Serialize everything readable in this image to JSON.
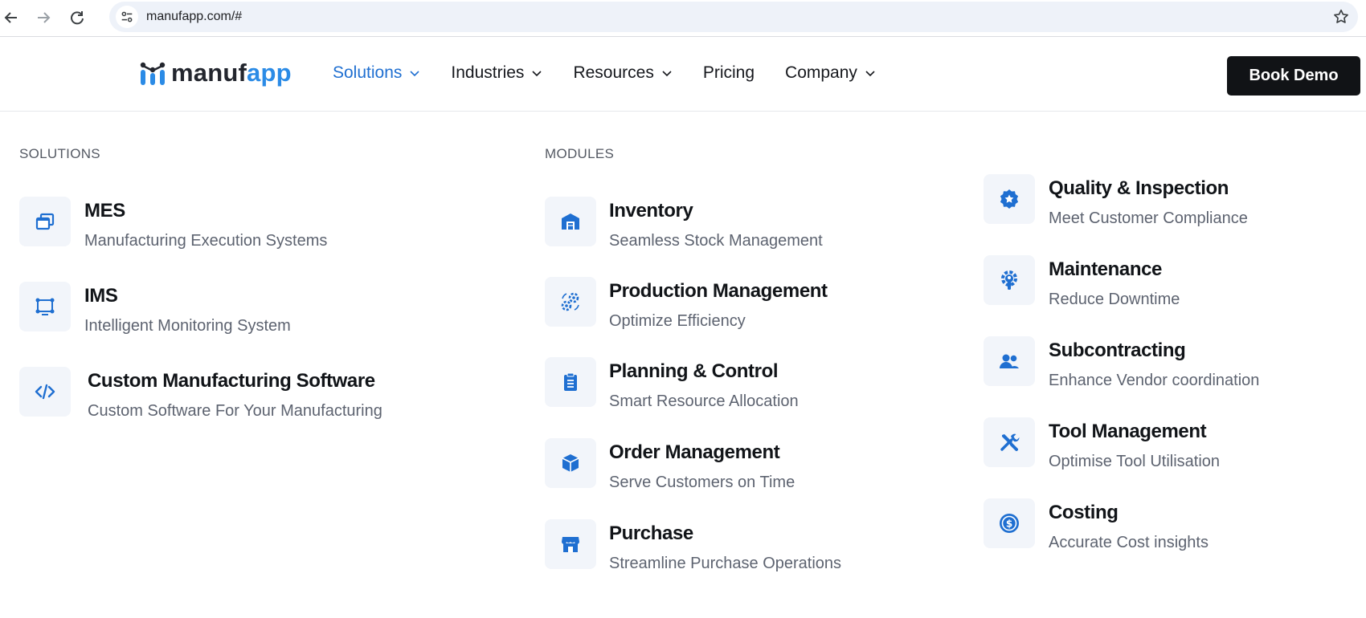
{
  "browser": {
    "url": "manufapp.com/#"
  },
  "header": {
    "logo_text_dark": "manuf",
    "logo_text_blue": "app",
    "menu": [
      {
        "label": "Solutions",
        "has_dropdown": true,
        "active": true
      },
      {
        "label": "Industries",
        "has_dropdown": true
      },
      {
        "label": "Resources",
        "has_dropdown": true
      },
      {
        "label": "Pricing",
        "has_dropdown": false
      },
      {
        "label": "Company",
        "has_dropdown": true
      }
    ],
    "cta_label": "Book Demo"
  },
  "colors": {
    "accent": "#1f6fd1",
    "icon_blue": "#1f6fd1",
    "tile_bg": "#f2f5fa",
    "cta_bg": "#111316"
  },
  "mega_menu": {
    "solutions_heading": "SOLUTIONS",
    "modules_heading": "MODULES",
    "solutions": [
      {
        "title": "MES",
        "subtitle": "Manufacturing Execution Systems",
        "icon": "windows-icon"
      },
      {
        "title": "IMS",
        "subtitle": "Intelligent Monitoring System",
        "icon": "monitoring-icon"
      },
      {
        "title": "Custom Manufacturing Software",
        "subtitle": "Custom Software For Your Manufacturing",
        "icon": "code-icon"
      }
    ],
    "modules_col1": [
      {
        "title": "Inventory",
        "subtitle": "Seamless Stock Management",
        "icon": "warehouse-icon"
      },
      {
        "title": "Production Management",
        "subtitle": "Optimize Efficiency",
        "icon": "gears-icon"
      },
      {
        "title": "Planning & Control",
        "subtitle": "Smart Resource Allocation",
        "icon": "clipboard-icon"
      },
      {
        "title": "Order Management",
        "subtitle": "Serve Customers on Time",
        "icon": "box-icon"
      },
      {
        "title": "Purchase",
        "subtitle": "Streamline Purchase Operations",
        "icon": "store-icon"
      }
    ],
    "modules_col2": [
      {
        "title": "Quality & Inspection",
        "subtitle": "Meet Customer Compliance",
        "icon": "award-icon"
      },
      {
        "title": "Maintenance",
        "subtitle": "Reduce Downtime",
        "icon": "gear-wrench-icon"
      },
      {
        "title": "Subcontracting",
        "subtitle": "Enhance Vendor coordination",
        "icon": "users-icon"
      },
      {
        "title": "Tool Management",
        "subtitle": "Optimise Tool Utilisation",
        "icon": "tools-icon"
      },
      {
        "title": "Costing",
        "subtitle": "Accurate Cost insights",
        "icon": "dollar-coin-icon"
      }
    ]
  }
}
